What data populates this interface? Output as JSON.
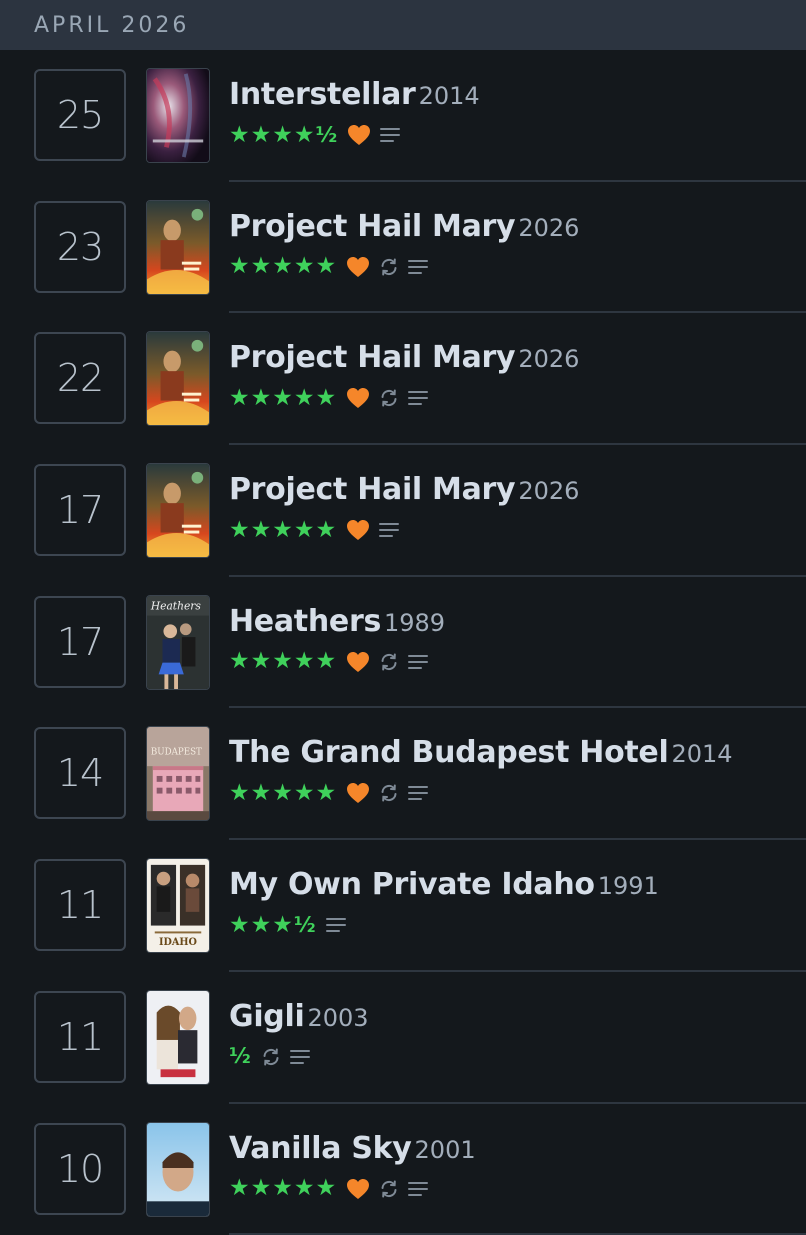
{
  "month_header": "APRIL 2026",
  "colors": {
    "star": "#3fd15b",
    "heart": "#f5862a",
    "icon": "#7f8a96",
    "background": "#14181c",
    "header": "#2c3440"
  },
  "entries": [
    {
      "day": "25",
      "title": "Interstellar",
      "year": "2014",
      "stars": "★★★★",
      "half": "½",
      "liked": true,
      "rewatch": false,
      "review": true,
      "poster": "interstellar"
    },
    {
      "day": "23",
      "title": "Project Hail Mary",
      "year": "2026",
      "stars": "★★★★★",
      "half": "",
      "liked": true,
      "rewatch": true,
      "review": true,
      "poster": "hail-mary"
    },
    {
      "day": "22",
      "title": "Project Hail Mary",
      "year": "2026",
      "stars": "★★★★★",
      "half": "",
      "liked": true,
      "rewatch": true,
      "review": true,
      "poster": "hail-mary"
    },
    {
      "day": "17",
      "title": "Project Hail Mary",
      "year": "2026",
      "stars": "★★★★★",
      "half": "",
      "liked": true,
      "rewatch": false,
      "review": true,
      "poster": "hail-mary"
    },
    {
      "day": "17",
      "title": "Heathers",
      "year": "1989",
      "stars": "★★★★★",
      "half": "",
      "liked": true,
      "rewatch": true,
      "review": true,
      "poster": "heathers",
      "poster_text": "Heathers"
    },
    {
      "day": "14",
      "title": "The Grand Budapest Hotel",
      "year": "2014",
      "stars": "★★★★★",
      "half": "",
      "liked": true,
      "rewatch": true,
      "review": true,
      "poster": "budapest",
      "poster_text": "BUDAPEST"
    },
    {
      "day": "11",
      "title": "My Own Private Idaho",
      "year": "1991",
      "stars": "★★★",
      "half": "½",
      "liked": false,
      "rewatch": false,
      "review": true,
      "poster": "idaho",
      "poster_text": "IDAHO"
    },
    {
      "day": "11",
      "title": "Gigli",
      "year": "2003",
      "stars": "",
      "half": "½",
      "liked": false,
      "rewatch": true,
      "review": true,
      "poster": "gigli"
    },
    {
      "day": "10",
      "title": "Vanilla Sky",
      "year": "2001",
      "stars": "★★★★★",
      "half": "",
      "liked": true,
      "rewatch": true,
      "review": true,
      "poster": "vanilla-sky"
    }
  ]
}
